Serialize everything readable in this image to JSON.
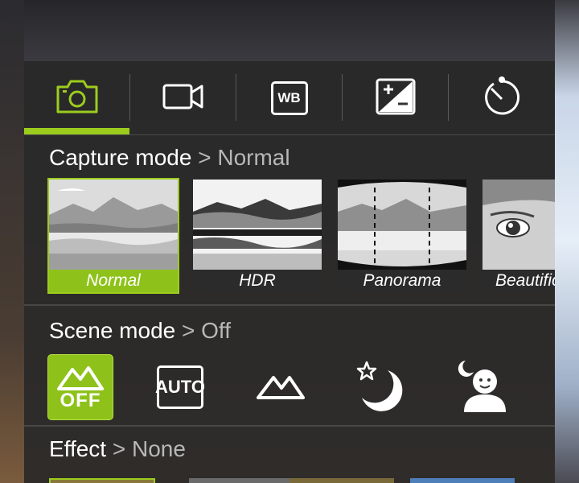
{
  "tabs": [
    {
      "name": "camera",
      "icon": "camera-icon",
      "selected": true
    },
    {
      "name": "video",
      "icon": "video-camera-icon",
      "selected": false
    },
    {
      "name": "white-balance",
      "icon": "wb-icon",
      "label": "WB",
      "selected": false
    },
    {
      "name": "exposure",
      "icon": "exposure-icon",
      "selected": false
    },
    {
      "name": "timer",
      "icon": "timer-icon",
      "selected": false
    }
  ],
  "capture": {
    "title": "Capture mode",
    "separator": ">",
    "value": "Normal",
    "items": [
      {
        "label": "Normal",
        "selected": true
      },
      {
        "label": "HDR",
        "selected": false
      },
      {
        "label": "Panorama",
        "selected": false
      },
      {
        "label": "Beautification",
        "selected": false
      }
    ]
  },
  "scene": {
    "title": "Scene mode",
    "separator": ">",
    "value": "Off",
    "items": [
      {
        "name": "off",
        "label": "OFF",
        "icon": "mountain-off-icon",
        "selected": true
      },
      {
        "name": "auto",
        "label": "AUTO",
        "icon": "auto-icon",
        "selected": false
      },
      {
        "name": "landscape",
        "icon": "mountain-icon",
        "selected": false
      },
      {
        "name": "night",
        "icon": "moon-star-icon",
        "selected": false
      },
      {
        "name": "night-portrait",
        "icon": "night-portrait-icon",
        "selected": false
      }
    ]
  },
  "effect": {
    "title": "Effect",
    "separator": ">",
    "value": "None"
  },
  "colors": {
    "accent": "#9ccc1d",
    "panel": "#282828"
  }
}
